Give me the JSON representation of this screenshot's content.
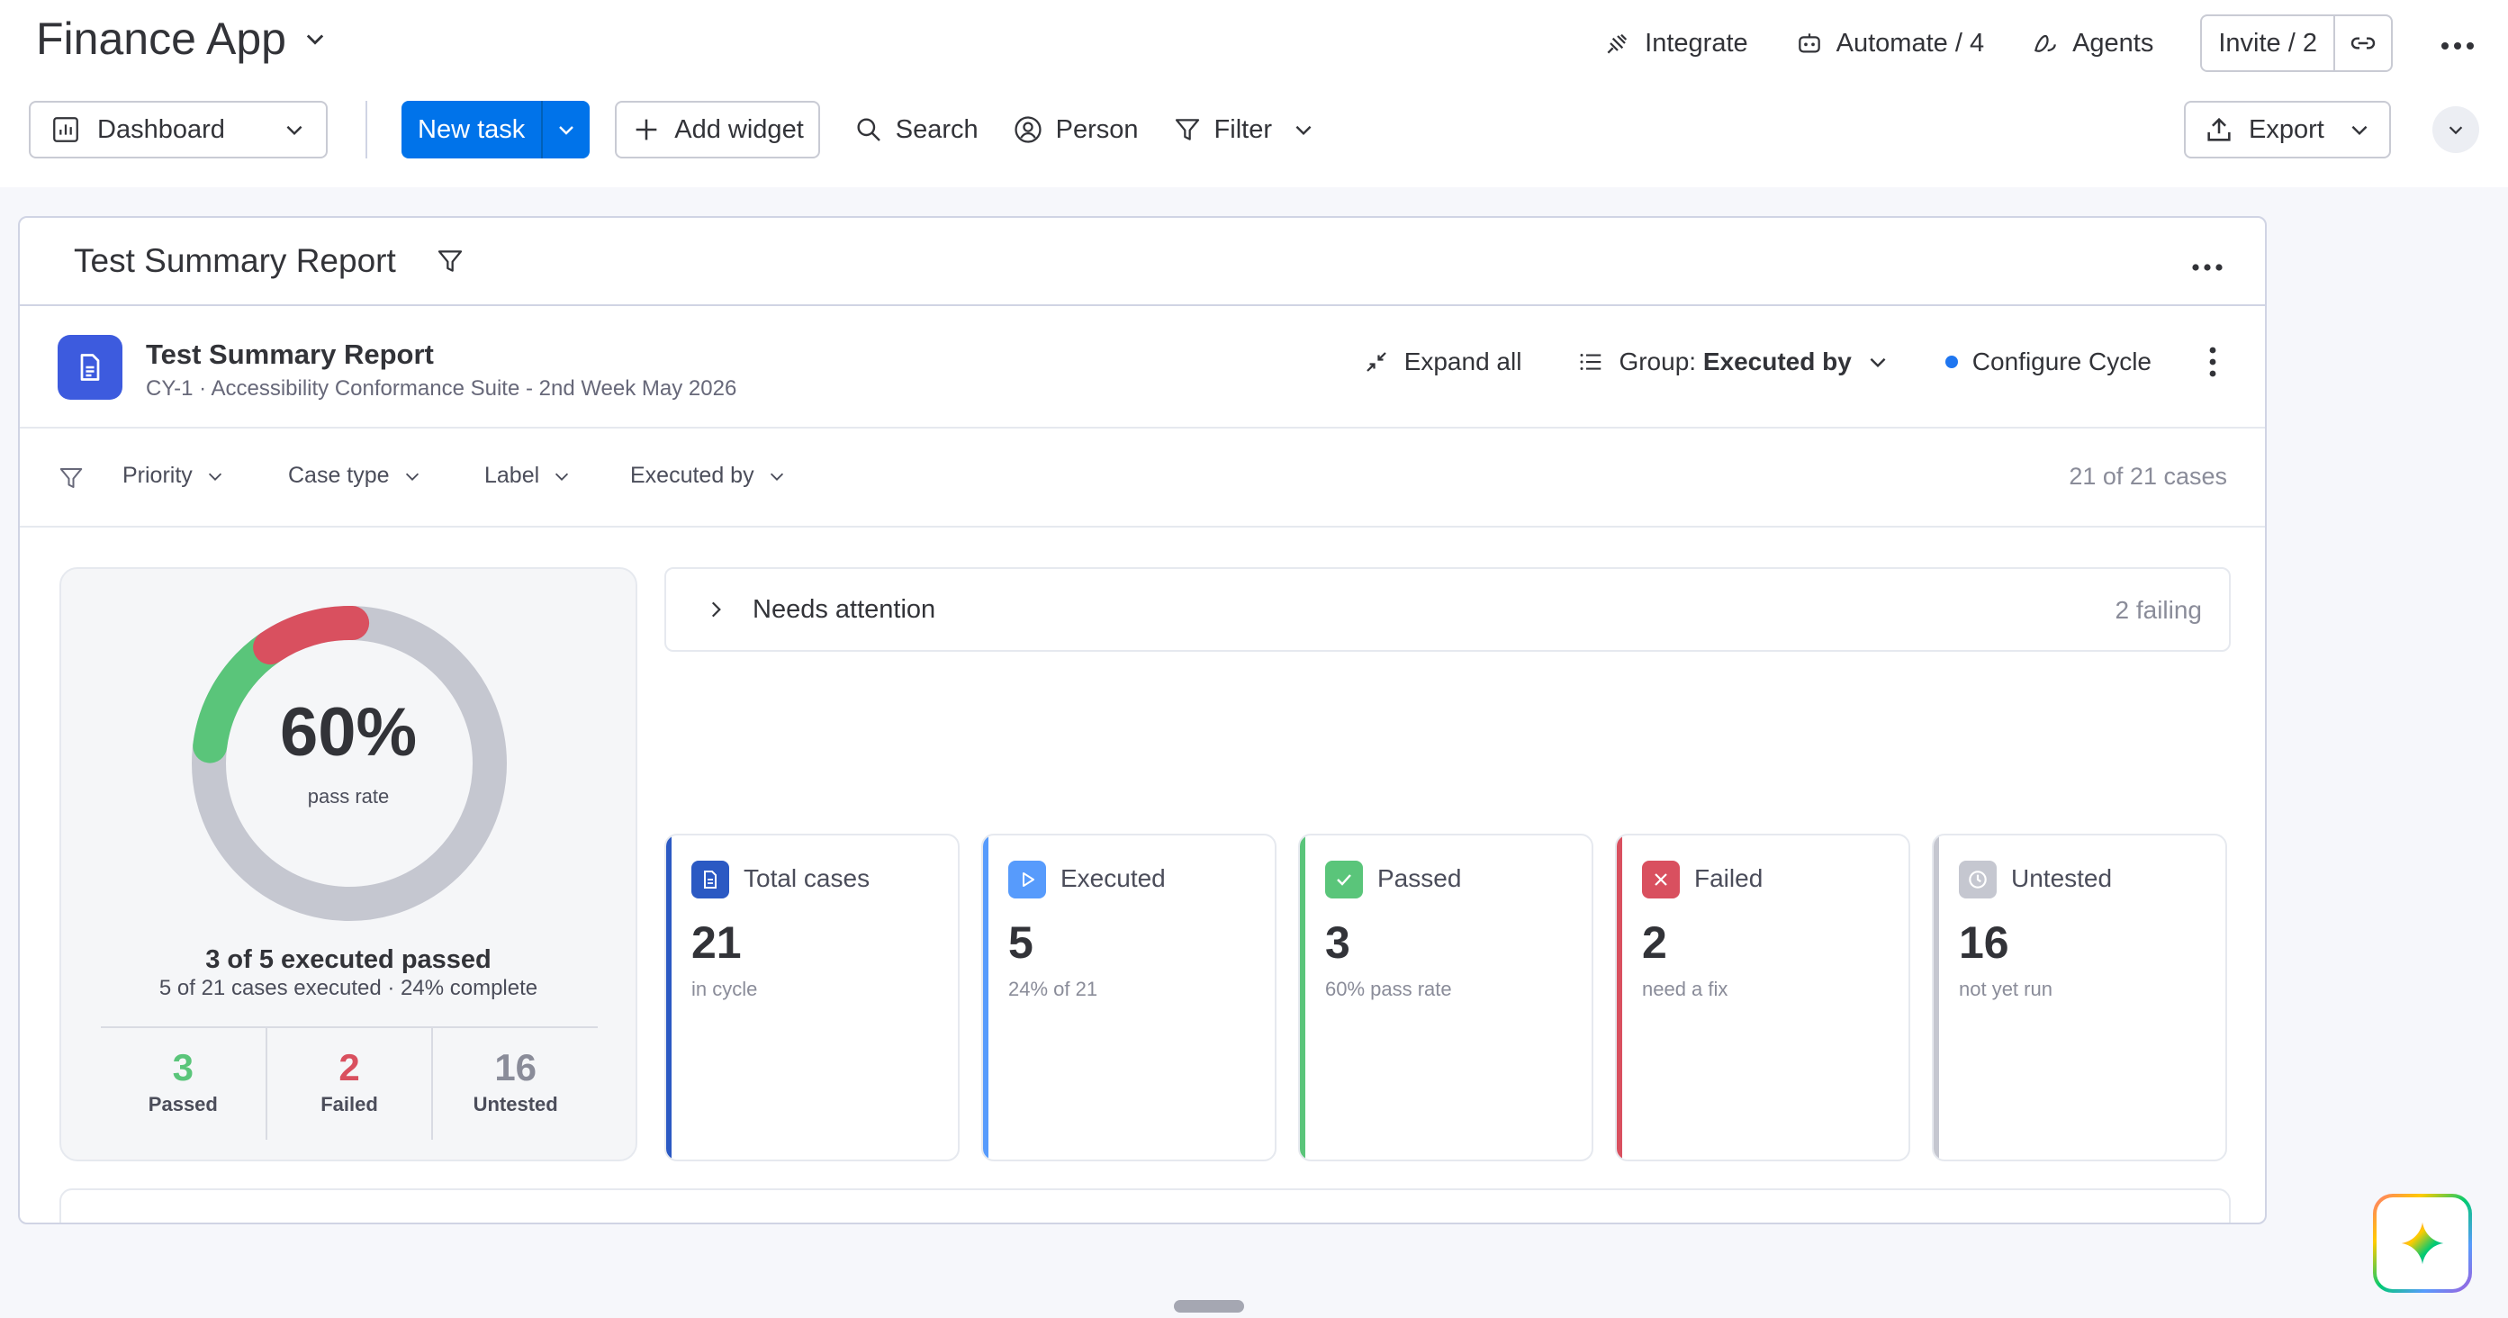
{
  "app": {
    "title": "Finance App"
  },
  "top_actions": {
    "integrate": "Integrate",
    "automate": "Automate / 4",
    "agents": "Agents",
    "invite": "Invite / 2"
  },
  "toolbar": {
    "dashboard": "Dashboard",
    "new_task": "New task",
    "add_widget": "Add widget",
    "search": "Search",
    "person": "Person",
    "filter": "Filter",
    "export": "Export"
  },
  "board": {
    "title": "Test Summary Report"
  },
  "widget": {
    "title": "Test Summary Report",
    "subtitle": "CY-1 · Accessibility Conformance Suite - 2nd Week May 2026",
    "expand_all": "Expand all",
    "group_prefix": "Group:",
    "group_value": "Executed by",
    "configure": "Configure Cycle",
    "accent": "#1f76f0"
  },
  "filters": {
    "items": [
      "Priority",
      "Case type",
      "Label",
      "Executed by"
    ],
    "count": "21 of 21 cases"
  },
  "pass_rate": {
    "value_label": "60%",
    "value": 0.6,
    "caption": "pass rate",
    "summary": "3 of 5 executed passed",
    "detail": "5 of 21 cases executed · 24% complete",
    "ring_segments": [
      {
        "name": "Passed",
        "value": 3,
        "color": "#5ac57a"
      },
      {
        "name": "Failed",
        "value": 2,
        "color": "#d9505f"
      },
      {
        "name": "Untested",
        "value": 16,
        "color": "#c5c7d0"
      }
    ],
    "stats": [
      {
        "value": "3",
        "label": "Passed",
        "color": "#5ac57a"
      },
      {
        "value": "2",
        "label": "Failed",
        "color": "#d9505f"
      },
      {
        "value": "16",
        "label": "Untested",
        "color": "#8a8c99"
      }
    ]
  },
  "needs_attention": {
    "title": "Needs attention",
    "count": "2 failing"
  },
  "kpis": [
    {
      "title": "Total cases",
      "value": "21",
      "sub": "in cycle",
      "color": "#2b59c3",
      "icon": "document-icon"
    },
    {
      "title": "Executed",
      "value": "5",
      "sub": "24% of 21",
      "color": "#579bfc",
      "icon": "play-icon"
    },
    {
      "title": "Passed",
      "value": "3",
      "sub": "60% pass rate",
      "color": "#5ac57a",
      "icon": "check-icon"
    },
    {
      "title": "Failed",
      "value": "2",
      "sub": "need a fix",
      "color": "#d9505f",
      "icon": "close-icon"
    },
    {
      "title": "Untested",
      "value": "16",
      "sub": "not yet run",
      "color": "#c5c7d0",
      "icon": "clock-icon"
    }
  ]
}
